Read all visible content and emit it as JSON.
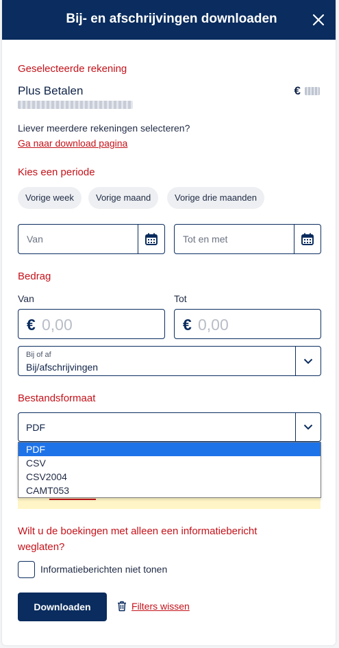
{
  "header": {
    "title": "Bij- en afschrijvingen downloaden",
    "close_icon": "close-icon"
  },
  "account": {
    "section_label": "Geselecteerde rekening",
    "name": "Plus Betalen",
    "currency": "€"
  },
  "multi": {
    "question": "Liever meerdere rekeningen selecteren?",
    "link": "Ga naar download pagina"
  },
  "period": {
    "section_label": "Kies een periode",
    "chips": [
      "Vorige week",
      "Vorige maand",
      "Vorige drie maanden"
    ],
    "from_placeholder": "Van",
    "to_placeholder": "Tot en met"
  },
  "amount": {
    "section_label": "Bedrag",
    "from_label": "Van",
    "to_label": "Tot",
    "currency": "€",
    "from_placeholder": "0,00",
    "to_placeholder": "0,00"
  },
  "direction": {
    "label": "Bij of af",
    "value": "Bij/afschrijvingen"
  },
  "format": {
    "section_label": "Bestandsformaat",
    "value": "PDF",
    "options": [
      "PDF",
      "CSV",
      "CSV2004",
      "CAMT053"
    ],
    "selected_index": 0
  },
  "info": {
    "question": "Wilt u de boekingen met alleen een informatiebericht weglaten?",
    "checkbox_label": "Informatieberichten niet tonen",
    "checked": false
  },
  "actions": {
    "download": "Downloaden",
    "clear": "Filters wissen"
  },
  "colors": {
    "primary": "#0a2c5e",
    "accent": "#c4121a",
    "selection": "#1e73e8"
  }
}
